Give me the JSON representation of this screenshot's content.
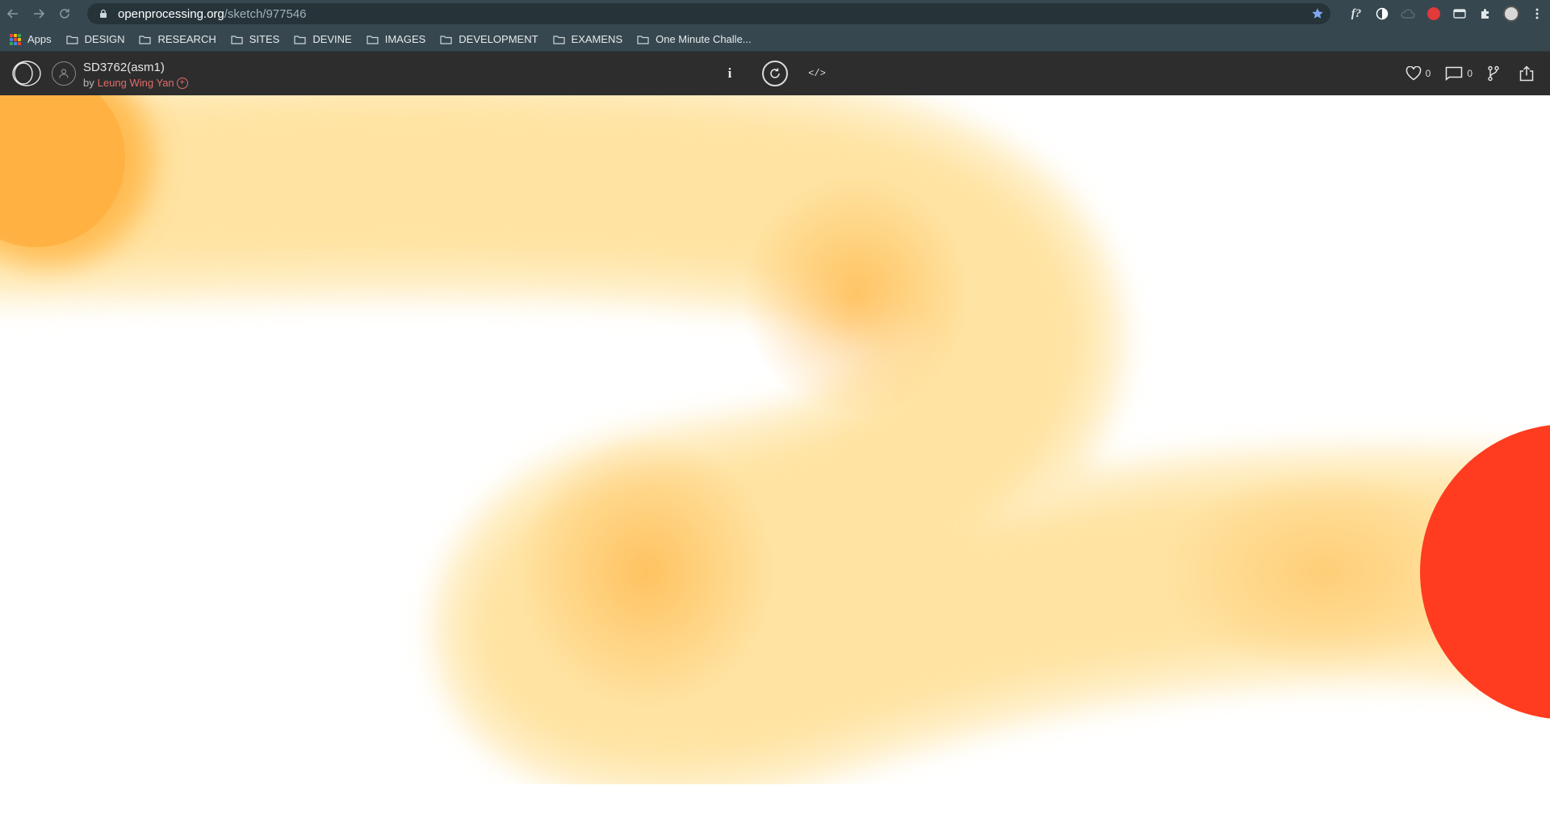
{
  "browser": {
    "url_host": "openprocessing.org",
    "url_path": "/sketch/977546",
    "bookmarks": [
      {
        "label": "Apps",
        "kind": "apps"
      },
      {
        "label": "DESIGN",
        "kind": "folder"
      },
      {
        "label": "RESEARCH",
        "kind": "folder"
      },
      {
        "label": "SITES",
        "kind": "folder"
      },
      {
        "label": "DEVINE",
        "kind": "folder"
      },
      {
        "label": "IMAGES",
        "kind": "folder"
      },
      {
        "label": "DEVELOPMENT",
        "kind": "folder"
      },
      {
        "label": "EXAMENS",
        "kind": "folder"
      },
      {
        "label": "One Minute Challe...",
        "kind": "folder"
      }
    ],
    "extensions": [
      "f?",
      "contrast-icon",
      "cloud-icon",
      "red-ext-icon",
      "window-icon",
      "puzzle-icon",
      "avatar",
      "kebab-menu-icon"
    ],
    "ext_font_label": "f?"
  },
  "sketch": {
    "title": "SD3762(asm1)",
    "by_prefix": "by",
    "author": "Leung Wing Yan",
    "follow_symbol": "+",
    "info_label": "i",
    "code_label": "</>",
    "likes": "0",
    "comments": "0"
  },
  "colors": {
    "chrome_bg": "#36474f",
    "toolbar_bg": "#2d2d2d",
    "author": "#e46b6b",
    "trail_light": "#ffe6a6",
    "trail_core": "#ffb648",
    "head_red": "#ff3b1f"
  }
}
